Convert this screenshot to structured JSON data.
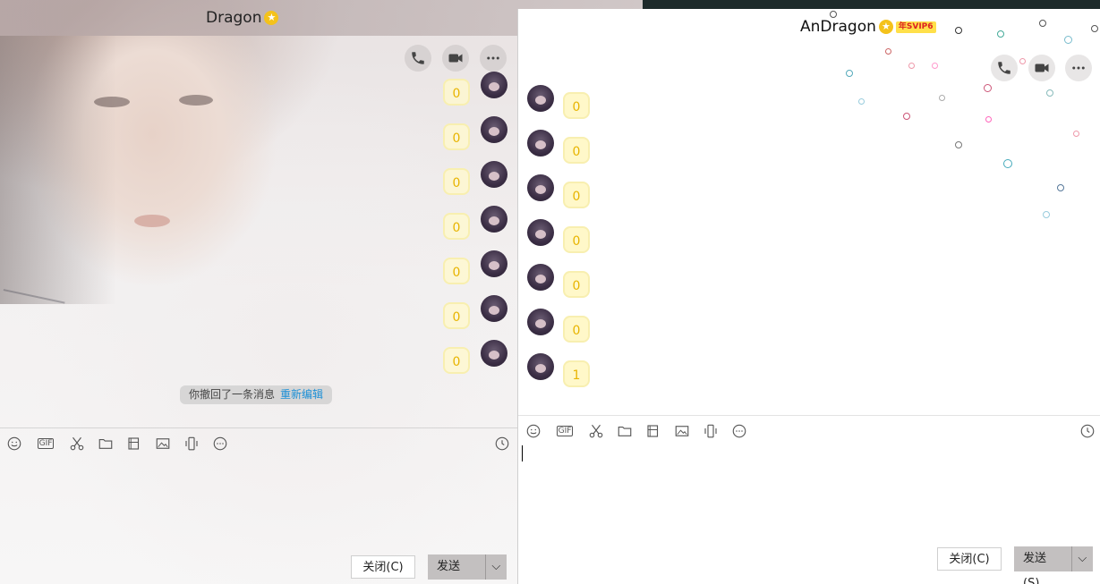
{
  "left_window": {
    "title": "Dragon",
    "vip_star": "★",
    "messages": [
      "0",
      "0",
      "0",
      "0",
      "0",
      "0",
      "0"
    ],
    "recall_notice": {
      "text": "你撤回了一条消息",
      "link": "重新编辑"
    },
    "close_label": "关闭(C)",
    "send_label": "发送(S)",
    "send_menu_glyph": "⌵"
  },
  "right_window": {
    "title": "AnDragon",
    "vip_star": "★",
    "vip_badge": "年SVIP6",
    "messages": [
      "0",
      "0",
      "0",
      "0",
      "0",
      "0",
      "1"
    ],
    "close_label": "关闭(C)",
    "send_label": "发送(S)",
    "send_menu_glyph": "⌵"
  },
  "toolbar": {
    "gif_label": "GIF",
    "icons": [
      "emoji-icon",
      "gif-icon",
      "scissors-icon",
      "folder-icon",
      "image-gallery-icon",
      "image-icon",
      "shake-icon",
      "more-icon",
      "history-icon"
    ]
  },
  "colors": {
    "bubble_text": "#e8b400",
    "link": "#1b8fd6",
    "vip_badge_bg": "#ffe04a"
  }
}
